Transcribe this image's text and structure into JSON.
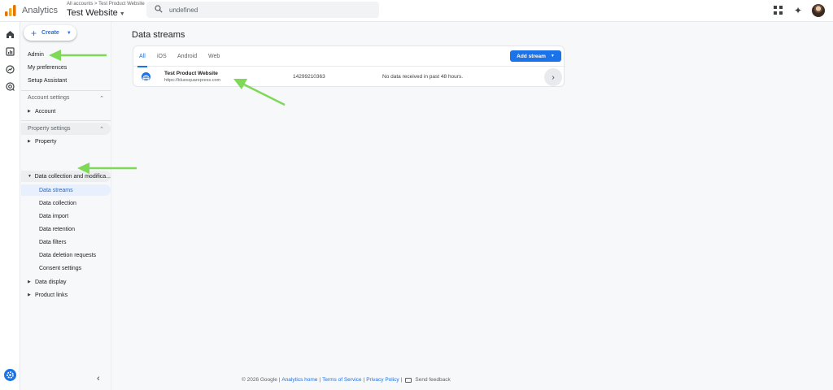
{
  "app": {
    "name": "Analytics",
    "breadcrumb": "All accounts > Test Product Website",
    "property": "Test Website"
  },
  "search": {
    "value": "undefined"
  },
  "sidebar": {
    "create_label": "Create",
    "top_items": [
      "Admin",
      "My preferences",
      "Setup Assistant"
    ],
    "account_settings": {
      "label": "Account settings",
      "items": [
        "Account"
      ]
    },
    "property_settings": {
      "label": "Property settings",
      "items": [
        "Property",
        "Data collection and modifica..."
      ],
      "sub_items": [
        "Data streams",
        "Data collection",
        "Data import",
        "Data retention",
        "Data filters",
        "Data deletion requests",
        "Consent settings"
      ],
      "more_items": [
        "Data display",
        "Product links"
      ]
    }
  },
  "main": {
    "title": "Data streams",
    "tabs": [
      "All",
      "iOS",
      "Android",
      "Web"
    ],
    "active_tab": "All",
    "add_stream_label": "Add stream",
    "streams": [
      {
        "name": "Test Product Website",
        "url": "https://bluesquarepress.com",
        "id": "14299210363",
        "status": "No data received in past 48 hours."
      }
    ]
  },
  "footer": {
    "copyright": "© 2026 Google |",
    "links": [
      "Analytics home",
      "Terms of Service",
      "Privacy Policy"
    ],
    "feedback": "Send feedback"
  },
  "colors": {
    "accent": "#1a73e8",
    "selected_bg": "#e8f0fe",
    "annotation_arrow": "#7ed957"
  }
}
